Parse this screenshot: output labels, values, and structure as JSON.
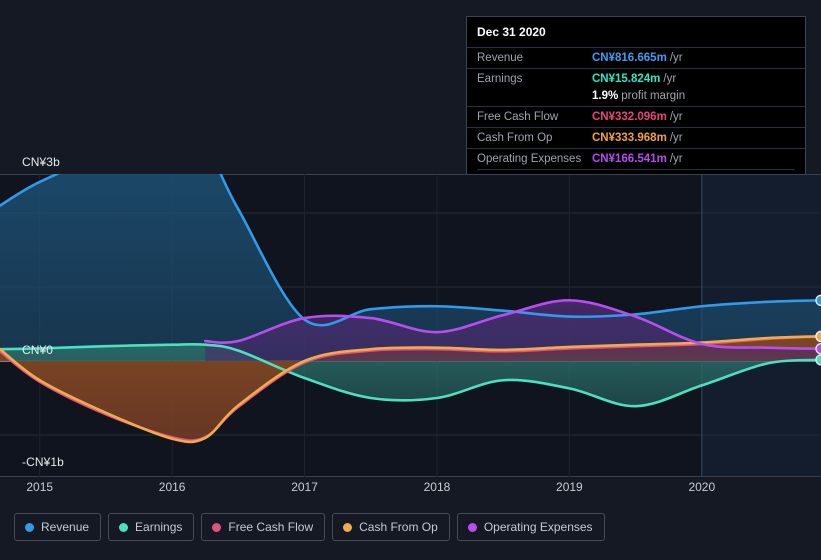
{
  "axes": {
    "y_top_label": "CN¥3b",
    "y_zero_label": "CN¥0",
    "y_bottom_label": "-CN¥1b",
    "x_labels": [
      "2015",
      "2016",
      "2017",
      "2018",
      "2019",
      "2020"
    ]
  },
  "tooltip": {
    "date": "Dec 31 2020",
    "rows": [
      {
        "label": "Revenue",
        "amount": "CN¥816.665m",
        "unit": "/yr",
        "color": "#3d9df3"
      },
      {
        "label": "Earnings",
        "amount": "CN¥15.824m",
        "unit": "/yr",
        "color": "#2ee6c5"
      },
      {
        "label": "Free Cash Flow",
        "amount": "CN¥332.096m",
        "unit": "/yr",
        "color": "#e8437f"
      },
      {
        "label": "Cash From Op",
        "amount": "CN¥333.968m",
        "unit": "/yr",
        "color": "#f0a33c"
      },
      {
        "label": "Operating Expenses",
        "amount": "CN¥166.541m",
        "unit": "/yr",
        "color": "#b44cf0"
      }
    ],
    "margin_value": "1.9%",
    "margin_text": "profit margin"
  },
  "legend": [
    {
      "label": "Revenue",
      "color": "#2f9bea"
    },
    {
      "label": "Earnings",
      "color": "#4ae0c0"
    },
    {
      "label": "Free Cash Flow",
      "color": "#e0527f"
    },
    {
      "label": "Cash From Op",
      "color": "#f0ab4c"
    },
    {
      "label": "Operating Expenses",
      "color": "#b94ef0"
    }
  ],
  "chart_data": {
    "type": "area",
    "title": "",
    "xlabel": "",
    "ylabel": "",
    "currency": "CN¥",
    "unit": "billions",
    "ylim": [
      -1.45,
      3.0
    ],
    "y_ticks": [
      3,
      2,
      1,
      0,
      -1
    ],
    "grid": true,
    "legend_position": "bottom",
    "x": [
      2014.7,
      2015.0,
      2015.5,
      2016.0,
      2016.25,
      2016.5,
      2017.0,
      2017.5,
      2018.0,
      2018.5,
      2019.0,
      2019.5,
      2020.0,
      2020.5,
      2020.9
    ],
    "x_range": [
      2014.7,
      2020.9
    ],
    "forecast_boundary": 2020.0,
    "series": [
      {
        "name": "Revenue",
        "color": "#2f9bea",
        "fill": "#1d4f73",
        "values": [
          2.1,
          2.42,
          2.78,
          2.93,
          2.88,
          2.05,
          0.56,
          0.7,
          0.74,
          0.68,
          0.6,
          0.63,
          0.74,
          0.8,
          0.82
        ]
      },
      {
        "name": "Earnings",
        "color": "#4ae0c0",
        "fill": "#2a6b67",
        "values": [
          0.16,
          0.17,
          0.2,
          0.22,
          0.22,
          0.14,
          -0.23,
          -0.5,
          -0.5,
          -0.26,
          -0.37,
          -0.61,
          -0.33,
          -0.03,
          0.016
        ]
      },
      {
        "name": "Free Cash Flow",
        "color": "#e0527f",
        "fill": "#7a2535",
        "values": [
          0.13,
          -0.28,
          -0.72,
          -1.03,
          -1.03,
          -0.62,
          -0.02,
          0.14,
          0.16,
          0.13,
          0.17,
          0.2,
          0.23,
          0.3,
          0.332
        ]
      },
      {
        "name": "Cash From Op",
        "color": "#f0ab4c",
        "fill": "#7a4a20",
        "values": [
          0.16,
          -0.26,
          -0.7,
          -1.05,
          -1.04,
          -0.6,
          0.0,
          0.16,
          0.18,
          0.15,
          0.19,
          0.22,
          0.25,
          0.31,
          0.334
        ]
      },
      {
        "name": "Operating Expenses",
        "color": "#b94ef0",
        "fill": "#4b2a6e",
        "values": [
          null,
          null,
          null,
          null,
          0.27,
          0.27,
          0.58,
          0.58,
          0.39,
          0.62,
          0.82,
          0.6,
          0.23,
          0.18,
          0.166
        ]
      }
    ]
  }
}
